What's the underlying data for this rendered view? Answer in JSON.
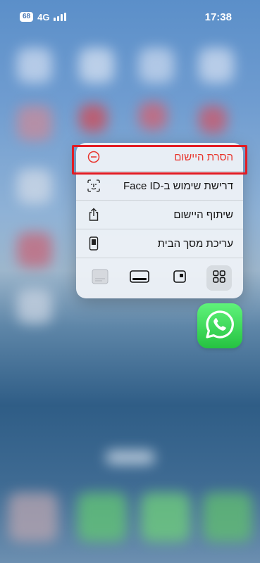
{
  "status_bar": {
    "battery": "68",
    "network": "4G",
    "time": "17:38"
  },
  "menu": {
    "items": [
      {
        "label": "הסרת היישום",
        "icon": "minus-circle-icon",
        "destructive": true
      },
      {
        "label": "דרישת שימוש ב-Face ID",
        "icon": "face-id-icon"
      },
      {
        "label": "שיתוף היישום",
        "icon": "share-icon"
      },
      {
        "label": "עריכת מסך הבית",
        "icon": "phone-icon"
      }
    ],
    "widget_sizes": [
      "widget-extra-large-icon",
      "widget-large-icon",
      "widget-medium-icon",
      "widget-small-icon"
    ],
    "selected_widget": "widget-small-icon"
  },
  "app": {
    "name_icon": "whatsapp-icon"
  },
  "colors": {
    "destructive": "#e8342c",
    "highlight_border": "#e21b23",
    "whatsapp_green": "#25c241"
  }
}
